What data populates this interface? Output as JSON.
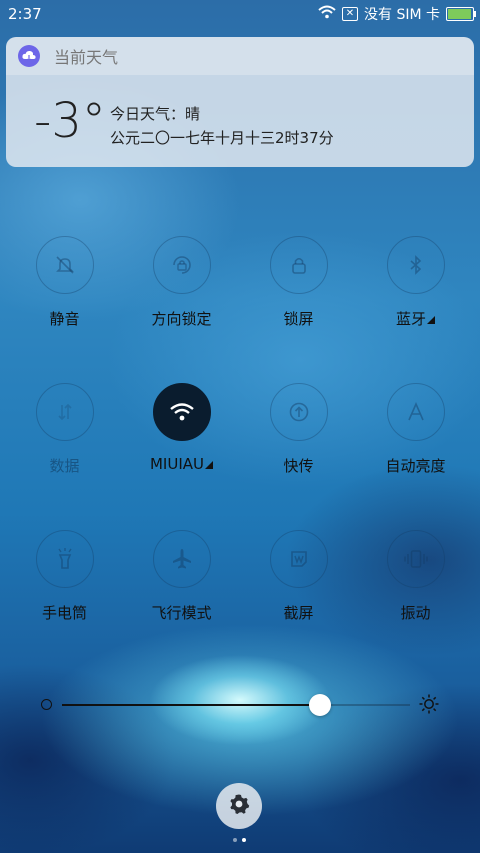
{
  "status_bar": {
    "time": "2:37",
    "carrier": "没有 SIM 卡",
    "battery_level": 0.95,
    "icons": [
      "wifi-icon",
      "no-sim-icon",
      "battery-icon"
    ]
  },
  "weather": {
    "app_name": "当前天气",
    "temperature": "-3°",
    "summary": "今日天气：晴",
    "date": "公元二〇一七年十月十三2时37分"
  },
  "toggles": [
    {
      "label": "静音",
      "icon": "bell-mute-icon",
      "active": false
    },
    {
      "label": "方向锁定",
      "icon": "rotation-lock-icon",
      "active": false
    },
    {
      "label": "锁屏",
      "icon": "lock-icon",
      "active": false
    },
    {
      "label": "蓝牙",
      "icon": "bluetooth-icon",
      "active": false,
      "expandable": true
    },
    {
      "label": "数据",
      "icon": "mobile-data-icon",
      "active": false,
      "disabled": true
    },
    {
      "label": "MIUIAU",
      "icon": "wifi-icon",
      "active": true,
      "expandable": true
    },
    {
      "label": "快传",
      "icon": "quick-transfer-icon",
      "active": false
    },
    {
      "label": "自动亮度",
      "icon": "auto-brightness-icon",
      "active": false
    },
    {
      "label": "手电筒",
      "icon": "flashlight-icon",
      "active": false
    },
    {
      "label": "飞行模式",
      "icon": "airplane-icon",
      "active": false
    },
    {
      "label": "截屏",
      "icon": "screenshot-icon",
      "active": false
    },
    {
      "label": "振动",
      "icon": "vibrate-icon",
      "active": false
    }
  ],
  "brightness": {
    "level": 0.74
  },
  "pager": {
    "pages": 2,
    "current": 2
  },
  "colors": {
    "active_toggle": "#0a1c2e",
    "weather_icon_bg": "#6d66e8",
    "battery": "#7ecb5b"
  }
}
